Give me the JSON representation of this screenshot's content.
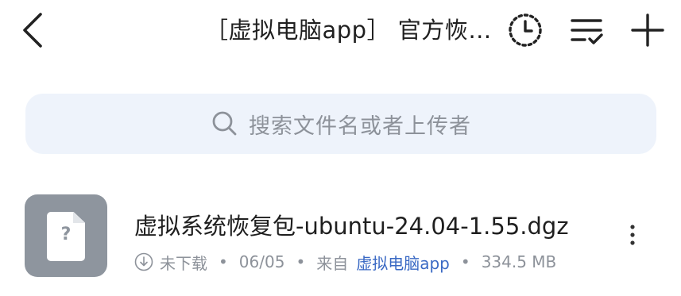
{
  "header": {
    "title": "［虚拟电脑app］ 官方恢…",
    "back_icon": "chevron-left-icon",
    "history_icon": "clock-history-icon",
    "sort_icon": "sort-list-check-icon",
    "add_icon": "plus-icon"
  },
  "search": {
    "placeholder": "搜索文件名或者上传者",
    "icon": "search-icon"
  },
  "files": [
    {
      "name": "虚拟系统恢复包-ubuntu-24.04-1.55.dgz",
      "thumb_glyph": "?",
      "status": "未下载",
      "date": "06/05",
      "from_label": "来自",
      "source": "虚拟电脑app",
      "size": "334.5 MB",
      "separator": "•"
    }
  ],
  "colors": {
    "accent_link": "#3a69c4",
    "search_bg": "#eef3fb",
    "thumb_bg": "#8e959e",
    "meta_text": "#8d929a"
  }
}
